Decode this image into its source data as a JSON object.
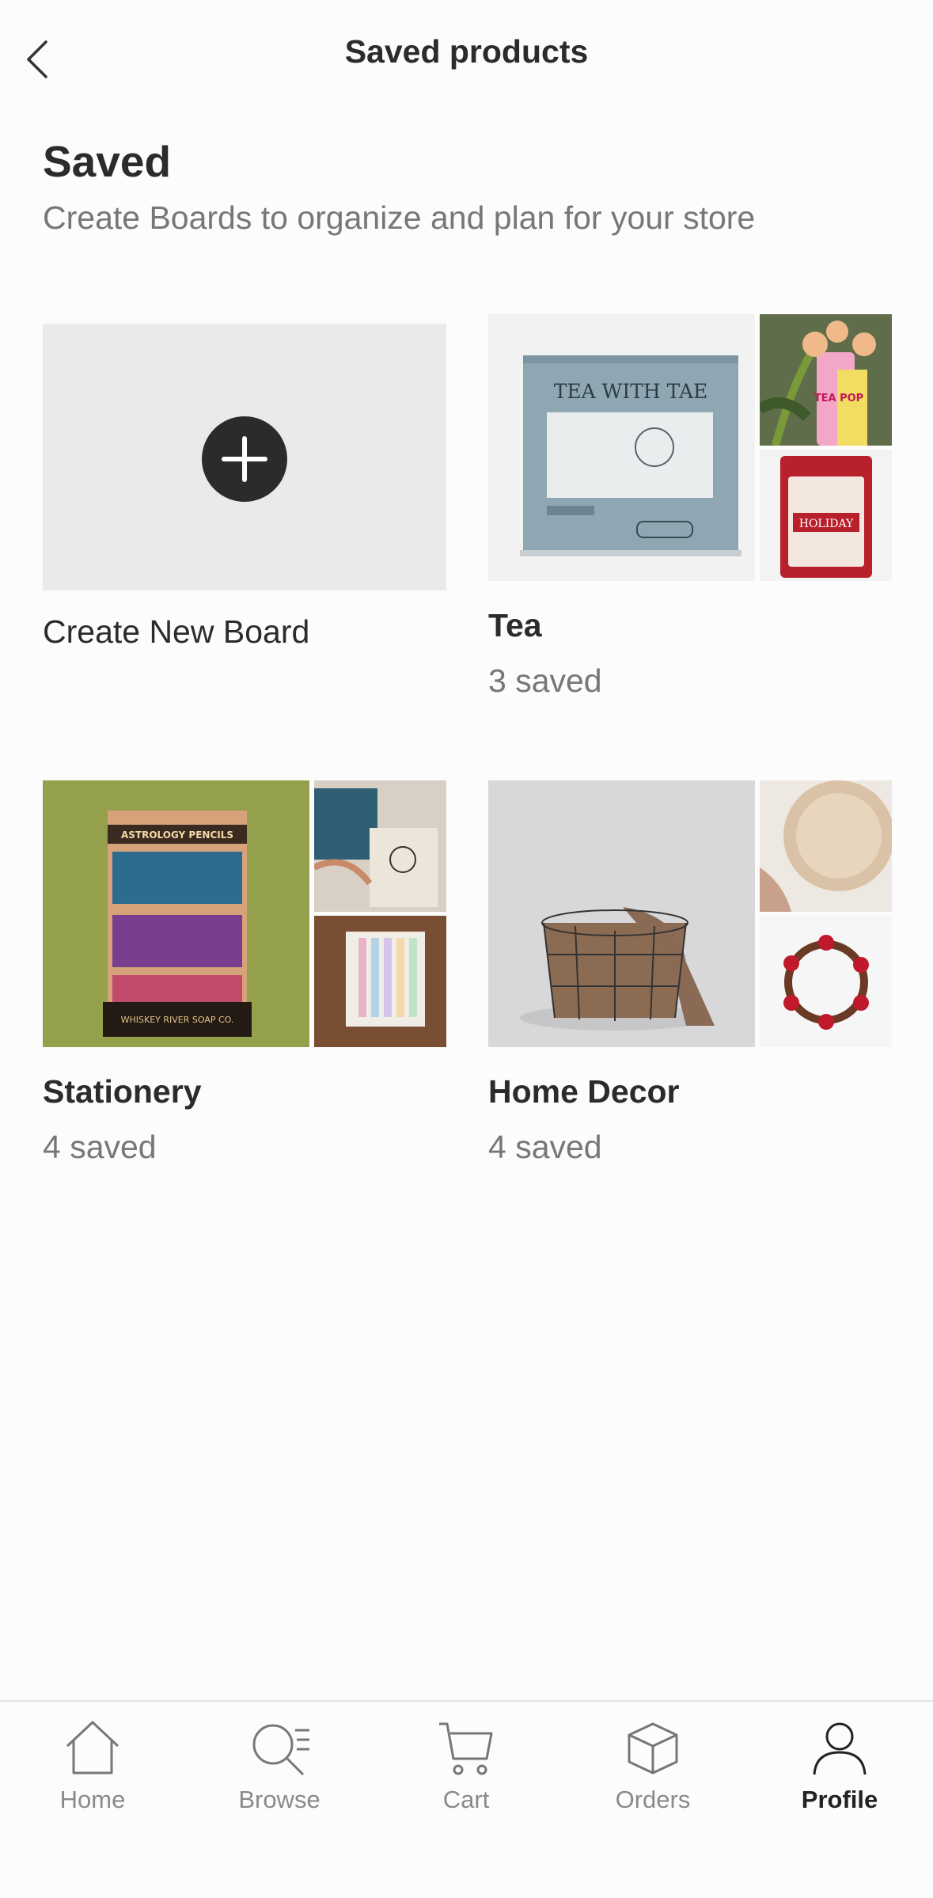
{
  "header": {
    "title": "Saved products",
    "back_icon": "chevron-left-icon"
  },
  "section": {
    "title": "Saved",
    "subtitle": "Create Boards to organize and plan for your store"
  },
  "new_board": {
    "label": "Create New Board",
    "icon": "plus-icon"
  },
  "boards": [
    {
      "name": "Tea",
      "count": "3 saved",
      "image_text": {
        "main_title": "TEA WITH TAE",
        "tin_label": "HOLIDAY",
        "pop_label": "TEA POP"
      }
    },
    {
      "name": "Stationery",
      "count": "4 saved",
      "image_text": {
        "display_title": "ASTROLOGY PENCILS",
        "display_brand": "WHISKEY RIVER SOAP CO."
      }
    },
    {
      "name": "Home Decor",
      "count": "4 saved"
    }
  ],
  "nav": {
    "items": [
      {
        "label": "Home",
        "icon": "home-icon",
        "active": false
      },
      {
        "label": "Browse",
        "icon": "browse-icon",
        "active": false
      },
      {
        "label": "Cart",
        "icon": "cart-icon",
        "active": false
      },
      {
        "label": "Orders",
        "icon": "orders-icon",
        "active": false
      },
      {
        "label": "Profile",
        "icon": "profile-icon",
        "active": true
      }
    ]
  }
}
